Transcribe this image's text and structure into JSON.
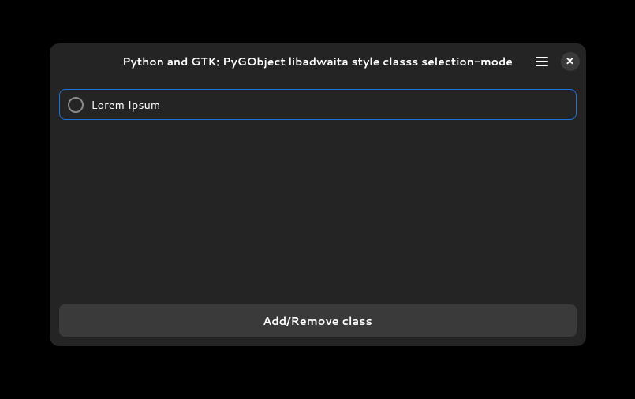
{
  "window": {
    "title": "Python and GTK: PyGObject libadwaita style classs selection-mode"
  },
  "row": {
    "label": "Lorem Ipsum"
  },
  "button": {
    "label": "Add/Remove class"
  }
}
